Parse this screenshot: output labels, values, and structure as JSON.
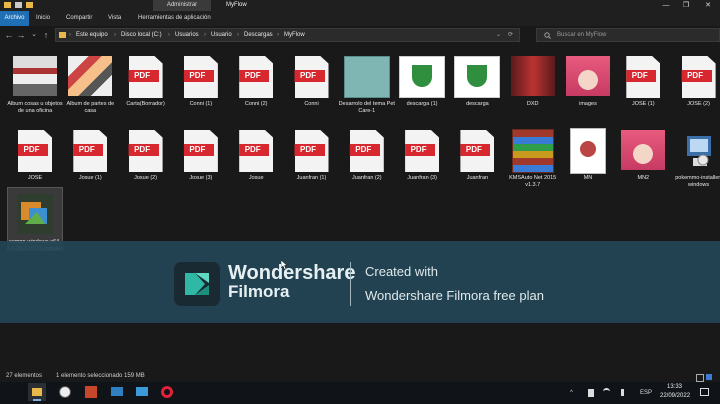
{
  "titlebar": {
    "context_tab": "Administrar",
    "title": "MyFlow",
    "minimize": "—",
    "maximize": "❐",
    "close": "✕"
  },
  "ribbon": {
    "tabs": [
      "Archivo",
      "Inicio",
      "Compartir",
      "Vista",
      "Herramientas de aplicación"
    ]
  },
  "nav": {
    "back": "←",
    "forward": "→",
    "recent": "⌄",
    "up": "↑",
    "refresh": "⟳",
    "dropdown": "⌄"
  },
  "address": {
    "crumbs": [
      "Este equipo",
      "Disco local (C:)",
      "Usuarios",
      "Usuario",
      "Descargas",
      "MyFlow"
    ],
    "separator": "›"
  },
  "search": {
    "placeholder": "Buscar en MyFlow"
  },
  "files": [
    {
      "label": "Album cosas u objetos de una oficina",
      "kind": "img",
      "pic": "pic-cool"
    },
    {
      "label": "Album de partes de casa",
      "kind": "img",
      "pic": "pic-cases"
    },
    {
      "label": "Carta(Borrador)",
      "kind": "pdf"
    },
    {
      "label": "Conni (1)",
      "kind": "pdf"
    },
    {
      "label": "Conni (2)",
      "kind": "pdf"
    },
    {
      "label": "Conni",
      "kind": "pdf"
    },
    {
      "label": "Desarrolo del tema Pet Care-1",
      "kind": "img",
      "pic": "pic-pet"
    },
    {
      "label": "descarga (1)",
      "kind": "img",
      "pic": "pic-escudo"
    },
    {
      "label": "descarga",
      "kind": "img",
      "pic": "pic-escudo"
    },
    {
      "label": "DXD",
      "kind": "img",
      "pic": "pic-dxd"
    },
    {
      "label": "images",
      "kind": "img",
      "pic": "pic-anime"
    },
    {
      "label": "JOSE (1)",
      "kind": "pdf"
    },
    {
      "label": "JOSE (2)",
      "kind": "pdf"
    },
    {
      "label": "JOSE",
      "kind": "pdf"
    },
    {
      "label": "Josue (1)",
      "kind": "pdf"
    },
    {
      "label": "Josue (2)",
      "kind": "pdf"
    },
    {
      "label": "Josue (3)",
      "kind": "pdf"
    },
    {
      "label": "Josue",
      "kind": "pdf"
    },
    {
      "label": "Juanfran (1)",
      "kind": "pdf"
    },
    {
      "label": "Juanfran (2)",
      "kind": "pdf"
    },
    {
      "label": "Juanfran (3)",
      "kind": "pdf"
    },
    {
      "label": "Juanfran",
      "kind": "pdf"
    },
    {
      "label": "KMSAuto Net 2015 v1.3.7",
      "kind": "winrar"
    },
    {
      "label": "MN",
      "kind": "mn"
    },
    {
      "label": "MN2",
      "kind": "img",
      "pic": "pic-anime"
    },
    {
      "label": "pokemmo-installer-windows",
      "kind": "installer"
    },
    {
      "label": "xampp-windows-x64-7.4.29-1-VC15-installer",
      "kind": "xampp",
      "selected": true
    }
  ],
  "pdf_badge": "PDF",
  "watermark": {
    "brand_line1": "Wondershare",
    "brand_line2": "Filmora",
    "created_with": "Created with",
    "plan": "Wondershare Filmora free plan"
  },
  "status": {
    "count": "27 elementos",
    "selection": "1 elemento seleccionado  159 MB"
  },
  "taskbar": {
    "apps": [
      "explorer",
      "obs",
      "powerpoint",
      "mail",
      "photos",
      "opera"
    ],
    "tray": {
      "chevron": "^",
      "language": "ESP"
    },
    "time": "13:33",
    "date": "22/09/2022"
  },
  "colors": {
    "accent": "#1f6fb5",
    "pdf_red": "#d7282f",
    "watermark_bg": "#244656"
  }
}
